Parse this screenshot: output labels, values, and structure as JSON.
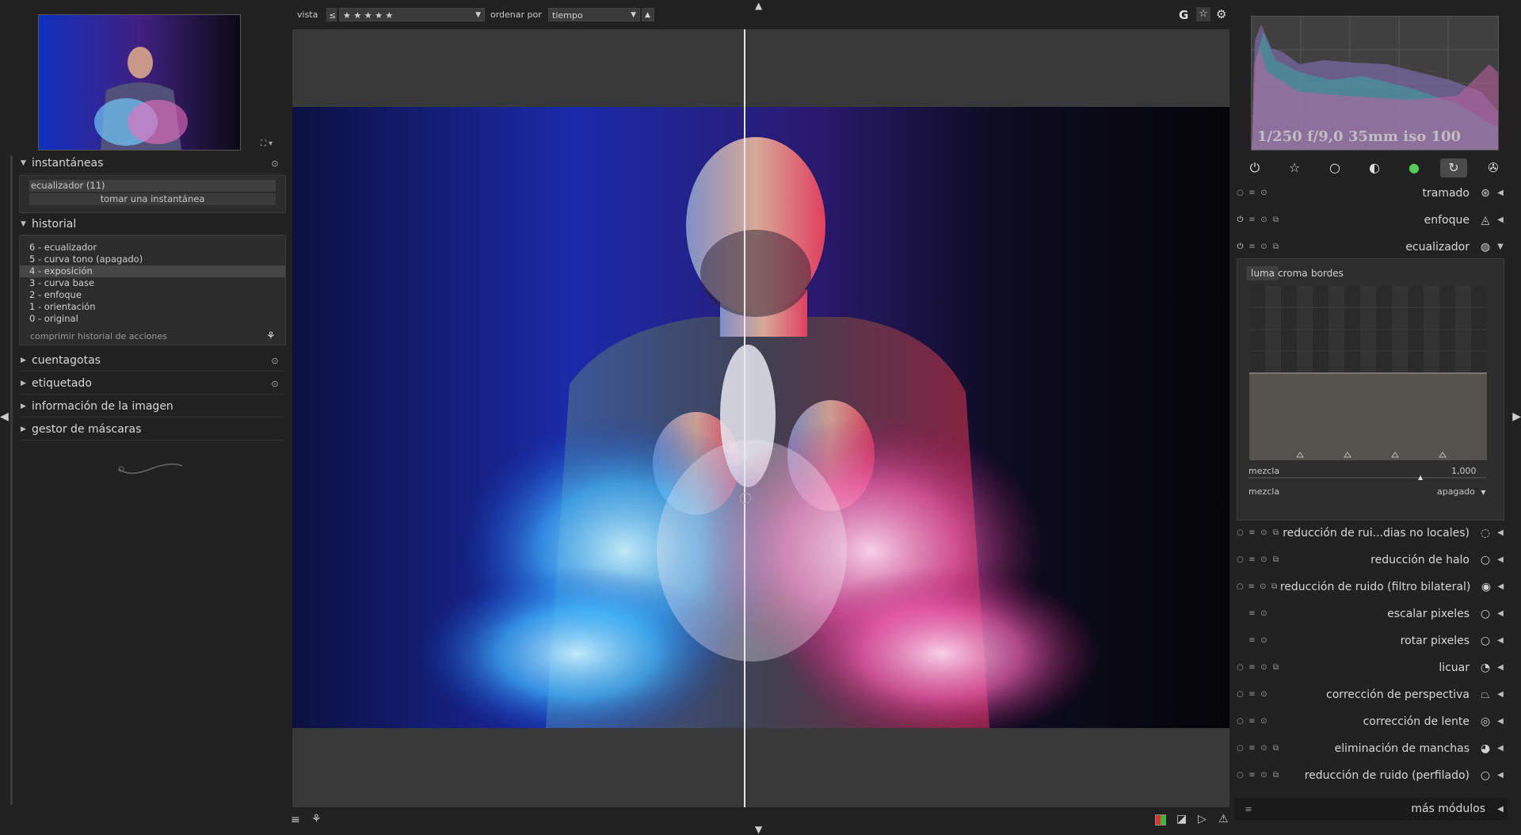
{
  "top_bar": {
    "view_label": "vista",
    "view_compare": "≤",
    "view_rating": "★ ★ ★ ★ ★",
    "sort_label": "ordenar por",
    "sort_value": "tiempo",
    "sort_dir": "▲",
    "g_label": "G"
  },
  "left": {
    "snapshots": {
      "title": "instantáneas",
      "item": "ecualizador (11)",
      "take_button": "tomar una instantánea"
    },
    "history": {
      "title": "historial",
      "items": [
        "6 - ecualizador",
        "5 - curva tono (apagado)",
        "4 - exposición",
        "3 - curva base",
        "2 - enfoque",
        "1 - orientación",
        "0 - original"
      ],
      "selected_index": 2,
      "compress_button": "comprimir historial de acciones"
    },
    "modules": [
      "cuentagotas",
      "etiquetado",
      "información de la imagen",
      "gestor de máscaras"
    ]
  },
  "right": {
    "exif": "1/250 f/9,0 35mm iso 100",
    "modules_top": [
      {
        "name": "tramado",
        "icon": "dither-icon"
      },
      {
        "name": "enfoque",
        "icon": "sharpen-icon"
      },
      {
        "name": "ecualizador",
        "icon": "equalizer-icon"
      }
    ],
    "equalizer": {
      "tabs": [
        "luma",
        "croma",
        "bordes"
      ],
      "selected_tab": "luma",
      "blend_label": "mezcla",
      "blend_value": "1,000",
      "mix_label": "mezcla",
      "mix_value": "apagado"
    },
    "modules_bottom": [
      "reducción de rui...dias no locales)",
      "reducción de halo",
      "reducción de ruido (filtro bilateral)",
      "escalar pixeles",
      "rotar pixeles",
      "licuar",
      "corrección de perspectiva",
      "corrección de lente",
      "eliminación de manchas",
      "reducción de ruido (perfilado)"
    ],
    "more_modules": "más módulos"
  },
  "colors": {
    "background": "#212121",
    "canvas": "#383838",
    "accent": "#4a4a4a"
  }
}
